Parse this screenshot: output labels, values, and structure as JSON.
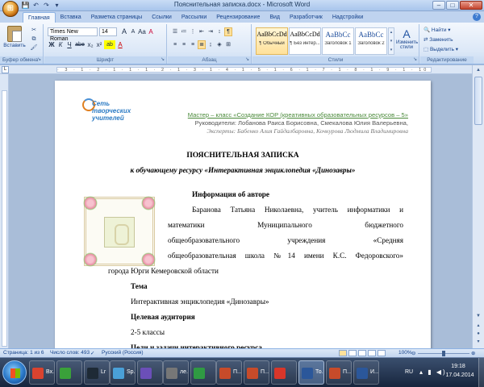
{
  "window": {
    "title": "Пояснительная записка.docx - Microsoft Word",
    "controls": {
      "minimize": "–",
      "maximize": "□",
      "close": "✕"
    }
  },
  "quick_access": {
    "save": "💾",
    "undo": "↶",
    "redo": "↷",
    "more": "▾"
  },
  "tabs": [
    {
      "label": "Главная",
      "active": true
    },
    {
      "label": "Вставка"
    },
    {
      "label": "Разметка страницы"
    },
    {
      "label": "Ссылки"
    },
    {
      "label": "Рассылки"
    },
    {
      "label": "Рецензирование"
    },
    {
      "label": "Вид"
    },
    {
      "label": "Разработчик"
    },
    {
      "label": "Надстройки"
    }
  ],
  "help": "?",
  "ribbon": {
    "clipboard": {
      "title": "Буфер обмена",
      "paste": "Вставить"
    },
    "font": {
      "title": "Шрифт",
      "name": "Times New Roman",
      "size": "14",
      "bold": "Ж",
      "italic": "К",
      "underline": "Ч",
      "strike": "abe",
      "sub": "x₂",
      "sup": "x²",
      "grow": "A",
      "shrink": "A",
      "aa": "Aa",
      "clear": "A",
      "highlight": "ab",
      "color": "A"
    },
    "paragraph": {
      "title": "Абзац"
    },
    "styles": {
      "title": "Стили",
      "items": [
        {
          "sample": "AaBbCcDd",
          "label": "¶ Обычный",
          "selected": true
        },
        {
          "sample": "AaBbCcDd",
          "label": "¶ Без интер..."
        },
        {
          "sample": "AaBbCc",
          "label": "Заголовок 1",
          "heading": true
        },
        {
          "sample": "AaBbCc",
          "label": "Заголовок 2",
          "heading": true
        }
      ],
      "change": "Изменить стили"
    },
    "editing": {
      "title": "Редактирование",
      "find": "Найти",
      "replace": "Заменить",
      "select": "Выделить"
    }
  },
  "ruler": {
    "marks": "· 3 · 1 · 2 · 1 · 1 · 1 · 2 · 1 · 3 · 1 · 4 · 1 · 5 · 1 · 6 · 1 · 7 · 1 · 8 · 1 · 9 · 1 · 10 · 1 · 11 · 1 · 12 · 1 · 13 · 1 · 14 · 1 · 15 · 1 · 16 · 1 · 17 ·"
  },
  "document": {
    "logo_text": [
      "Сеть",
      "творческих",
      "учителей"
    ],
    "header_line1": "Мастер – класс «Создание КОР (креативных образовательных ресурсов – 5»",
    "header_line2": "Руководители: Лобанова Раиса Борисовна, Смекалова Юлия Валерьевна,",
    "header_line3": "Эксперты: Бабенко Алия Гайдалбаровна, Кочкурова Людмила Владимировна",
    "title": "ПОЯСНИТЕЛЬНАЯ ЗАПИСКА",
    "subtitle": "к обучающему ресурсу «Интерактивная энциклопедия «Динозавры»",
    "author_heading": "Информация об авторе",
    "author_lines": [
      "Баранова Татьяна Николаевна, учитель информатики и",
      "математики Муниципального бюджетного",
      "общеобразовательного учреждения «Средняя",
      "общеобразовательная школа №14 имени К.С. Федоровского»"
    ],
    "author_tail": "города Юрги Кемеровской области",
    "topic_heading": "Тема",
    "topic": "Интерактивная энциклопедия «Динозавры»",
    "audience_heading": "Целевая аудитория",
    "audience": "2-5 классы",
    "goals_heading": "Цели и задачи интерактивного ресурса"
  },
  "statusbar": {
    "page": "Страница: 1 из 6",
    "words": "Число слов: 493",
    "lang": "Русский (Россия)",
    "zoom": "100%",
    "zoom_minus": "⊖",
    "zoom_plus": "⊕"
  },
  "taskbar": {
    "items": [
      {
        "label": "Вх...",
        "color": "#d9432f"
      },
      {
        "label": "",
        "color": "#3aa13a"
      },
      {
        "label": "Lr",
        "color": "#1e2a36"
      },
      {
        "label": "Sp...",
        "color": "#4aa0d8"
      },
      {
        "label": "",
        "color": "#6b4fb8"
      },
      {
        "label": "ле...",
        "color": "#777777"
      },
      {
        "label": "",
        "color": "#2f9a43"
      },
      {
        "label": "П...",
        "color": "#c74b2a"
      },
      {
        "label": "П...",
        "color": "#c74b2a"
      },
      {
        "label": "",
        "color": "#d8362a"
      },
      {
        "label": "То...",
        "color": "#2b579a",
        "active": true
      },
      {
        "label": "П...",
        "color": "#c74b2a"
      },
      {
        "label": "И...",
        "color": "#2b579a"
      }
    ],
    "lang": "RU",
    "time": "19:18",
    "date": "17.04.2014"
  },
  "colors": {
    "accent": "#15428b",
    "ribbon": "#dce8f7",
    "taskbar": "#17253d"
  }
}
